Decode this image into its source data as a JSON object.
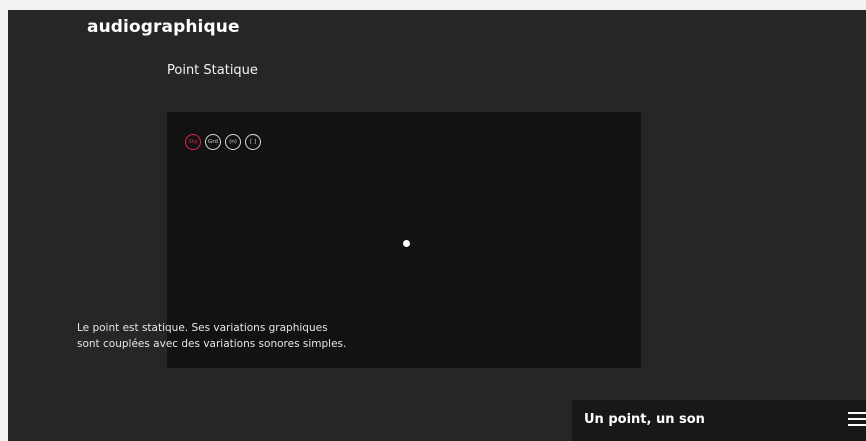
{
  "header": {
    "brand": "audiographique",
    "page_title": "Point Statique"
  },
  "stage": {
    "controls": [
      {
        "label": "Stp",
        "active": true
      },
      {
        "label": "Grd",
        "active": false
      },
      {
        "label": "(n)",
        "active": false
      },
      {
        "label": "[ ]",
        "active": false
      }
    ]
  },
  "description": {
    "line1": "Le point est statique. Ses variations graphiques",
    "line2": "sont couplées avec des variations sonores simples."
  },
  "footer": {
    "title": "Un point, un son",
    "menu_icon": "hamburger-menu-icon"
  },
  "colors": {
    "background": "#262626",
    "stage": "#121212",
    "accent": "#e0254d",
    "text": "#ffffff"
  }
}
